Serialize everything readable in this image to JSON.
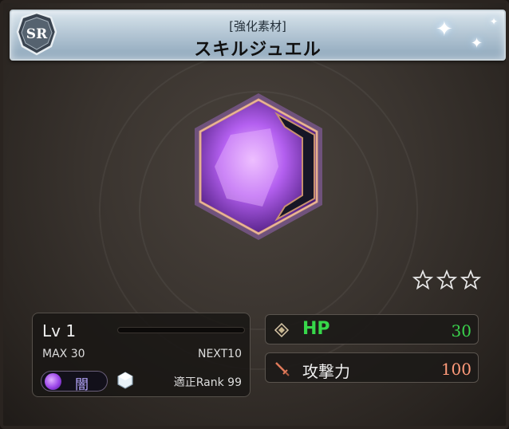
{
  "header": {
    "category": "[強化素材]",
    "name": "スキルジュエル",
    "rarity": "SR"
  },
  "item": {
    "gem_icon": "dark-skill-jewel-icon",
    "stars": 3,
    "star_icon": "empty-star-icon"
  },
  "level": {
    "label": "Lv 1",
    "max": "MAX 30",
    "next": "NEXT10",
    "exp_fraction": 0
  },
  "element": {
    "icon": "dark-element-icon",
    "label": "闇"
  },
  "rank": {
    "icon": "rank-crystal-icon",
    "label": "適正Rank 99"
  },
  "stats": {
    "hp": {
      "label": "HP",
      "value": "30",
      "icon": "diamond-icon"
    },
    "attack": {
      "label": "攻撃力",
      "value": "100",
      "icon": "sword-icon"
    }
  },
  "colors": {
    "hp": "#37d84a",
    "attack_value": "#ff9a7a",
    "header_bg": "#b9cbd8",
    "dark_element": "#9a44e8"
  }
}
